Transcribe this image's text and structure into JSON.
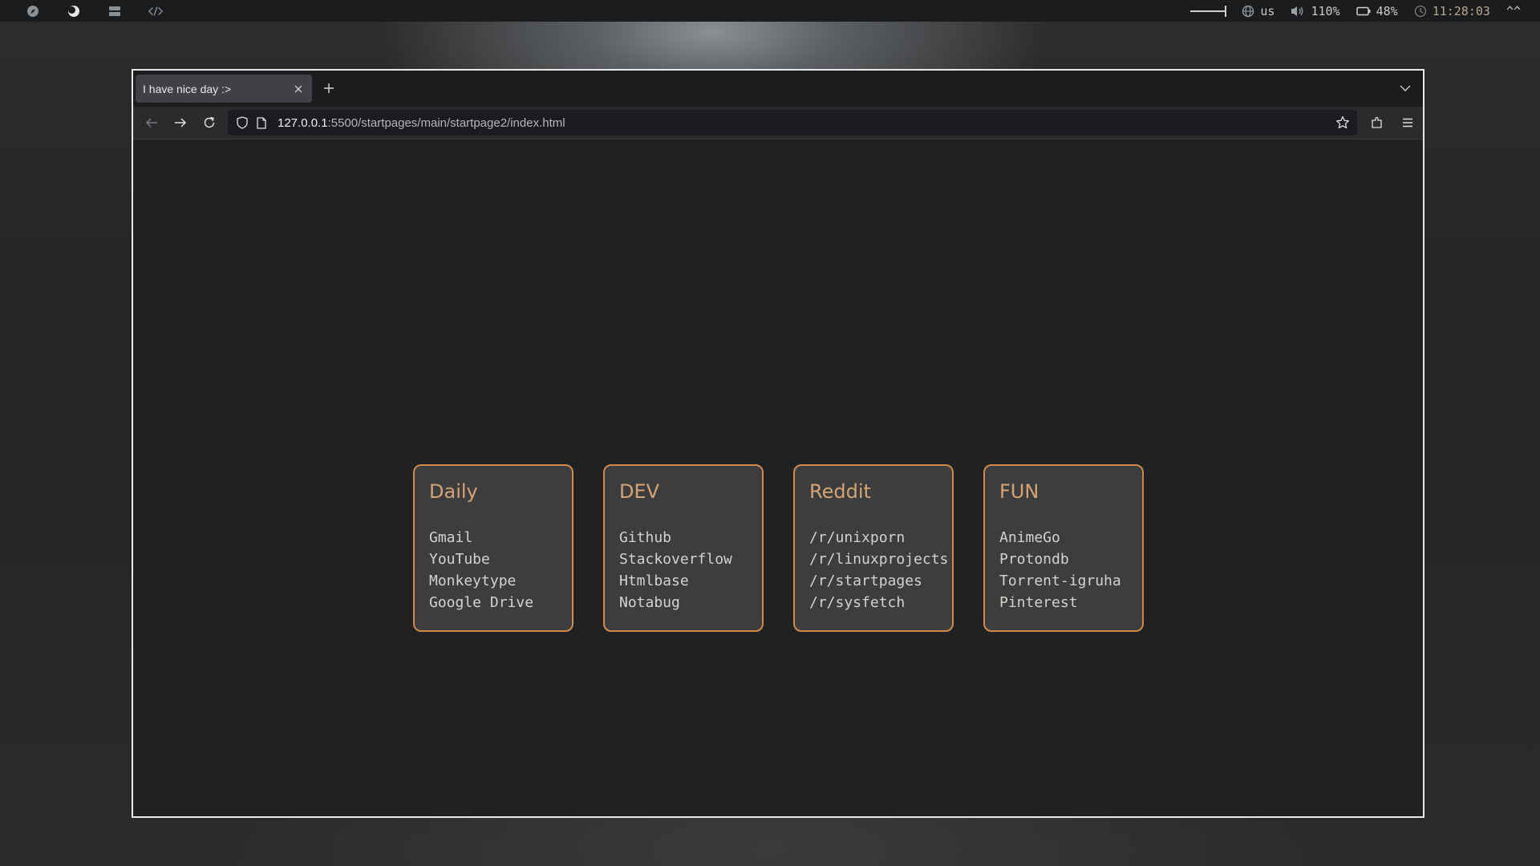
{
  "topbar": {
    "workspaces": [
      {
        "icon": "compass-icon"
      },
      {
        "icon": "moon-icon"
      },
      {
        "icon": "server-icon"
      },
      {
        "icon": "code-icon"
      }
    ],
    "keyboard_layout": "us",
    "volume": "110%",
    "battery": "48%",
    "clock": "11:28:03",
    "tray_end": "^^"
  },
  "browser": {
    "tab_title": "I have nice day :>",
    "url_host": "127.0.0.1",
    "url_path": ":5500/startpages/main/startpage2/index.html"
  },
  "cards": [
    {
      "title": "Daily",
      "links": [
        "Gmail",
        "YouTube",
        "Monkeytype",
        "Google Drive"
      ]
    },
    {
      "title": "DEV",
      "links": [
        "Github",
        "Stackoverflow",
        "Htmlbase",
        "Notabug"
      ]
    },
    {
      "title": "Reddit",
      "links": [
        "/r/unixporn",
        "/r/linuxprojects",
        "/r/startpages",
        "/r/sysfetch"
      ]
    },
    {
      "title": "FUN",
      "links": [
        "AnimeGo",
        "Protondb",
        "Torrent-igruha",
        "Pinterest"
      ]
    }
  ],
  "colors": {
    "accent": "#d08a4a",
    "card_title": "#d6a374",
    "card_bg": "#3c3d3f",
    "page_bg": "#1f2123"
  }
}
